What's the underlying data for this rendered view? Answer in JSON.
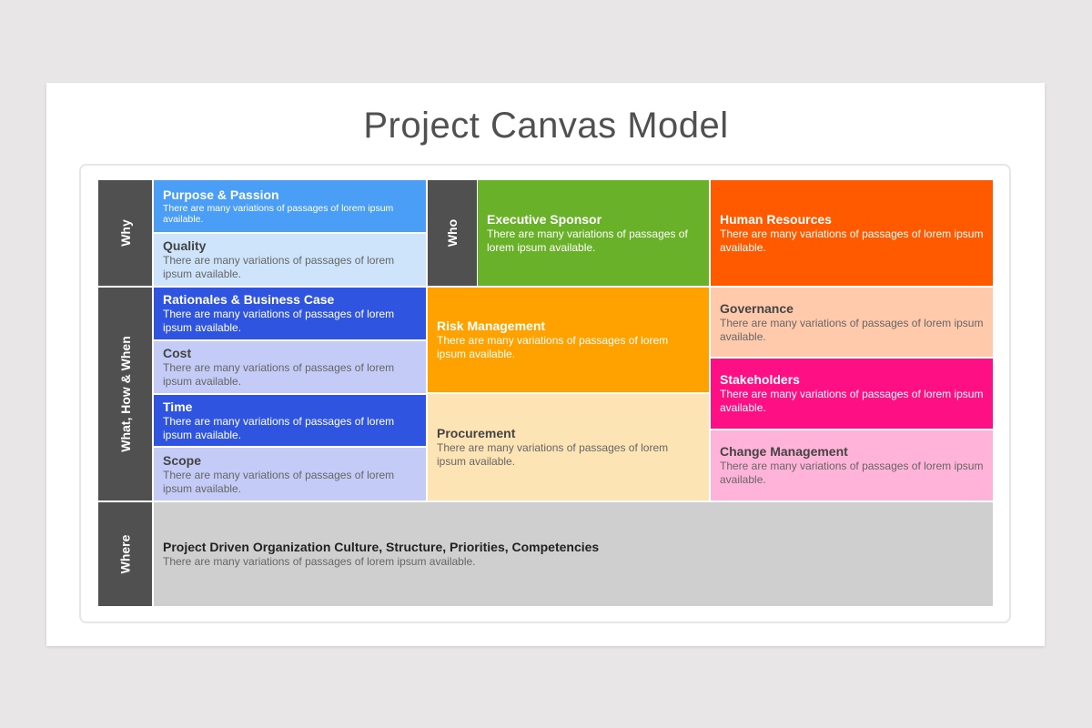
{
  "title": "Project Canvas Model",
  "lorem_short": "There are many variations of passages of lorem ipsum available.",
  "side_labels": {
    "why": "Why",
    "who": "Who",
    "what": "What, How & When",
    "where": "Where"
  },
  "blocks": {
    "purpose": {
      "title": "Purpose & Passion",
      "text": "There are many variations of passages of lorem ipsum available."
    },
    "quality": {
      "title": "Quality",
      "text": "There are many variations of passages of lorem ipsum available."
    },
    "executive_sponsor": {
      "title": "Executive Sponsor",
      "text": "There are many variations of passages of lorem ipsum available."
    },
    "human_resources": {
      "title": "Human Resources",
      "text": "There are many variations of passages of lorem ipsum available."
    },
    "rationales": {
      "title": "Rationales & Business Case",
      "text": "There are many variations of passages of lorem ipsum available."
    },
    "cost": {
      "title": "Cost",
      "text": "There are many variations of passages of lorem ipsum available."
    },
    "time": {
      "title": "Time",
      "text": "There are many variations of passages of lorem ipsum available."
    },
    "scope": {
      "title": "Scope",
      "text": "There are many variations of passages of lorem ipsum available."
    },
    "risk": {
      "title": "Risk Management",
      "text": "There are many variations of passages of lorem ipsum available."
    },
    "procurement": {
      "title": "Procurement",
      "text": "There are many variations of passages of lorem ipsum available."
    },
    "governance": {
      "title": "Governance",
      "text": "There are many variations of passages of lorem ipsum available."
    },
    "stakeholders": {
      "title": "Stakeholders",
      "text": "There are many variations of passages of lorem ipsum available."
    },
    "change": {
      "title": "Change Management",
      "text": "There are many variations of passages of lorem ipsum available."
    },
    "where": {
      "title": "Project Driven Organization Culture, Structure, Priorities, Competencies",
      "text": "There are many variations of passages of lorem ipsum available."
    }
  },
  "colors": {
    "side": "#505050",
    "purpose": "#4a9ef5",
    "quality": "#cde4fb",
    "executive_sponsor": "#6ab12a",
    "human_resources": "#ff5a00",
    "rationales": "#2f55e0",
    "cost": "#c3cbf6",
    "time": "#2f55e0",
    "scope": "#c3cbf6",
    "risk": "#ffa200",
    "procurement": "#fde4b5",
    "governance": "#ffc9ac",
    "stakeholders": "#ff0f84",
    "change": "#ffb3d9",
    "where": "#cfcfcf"
  }
}
